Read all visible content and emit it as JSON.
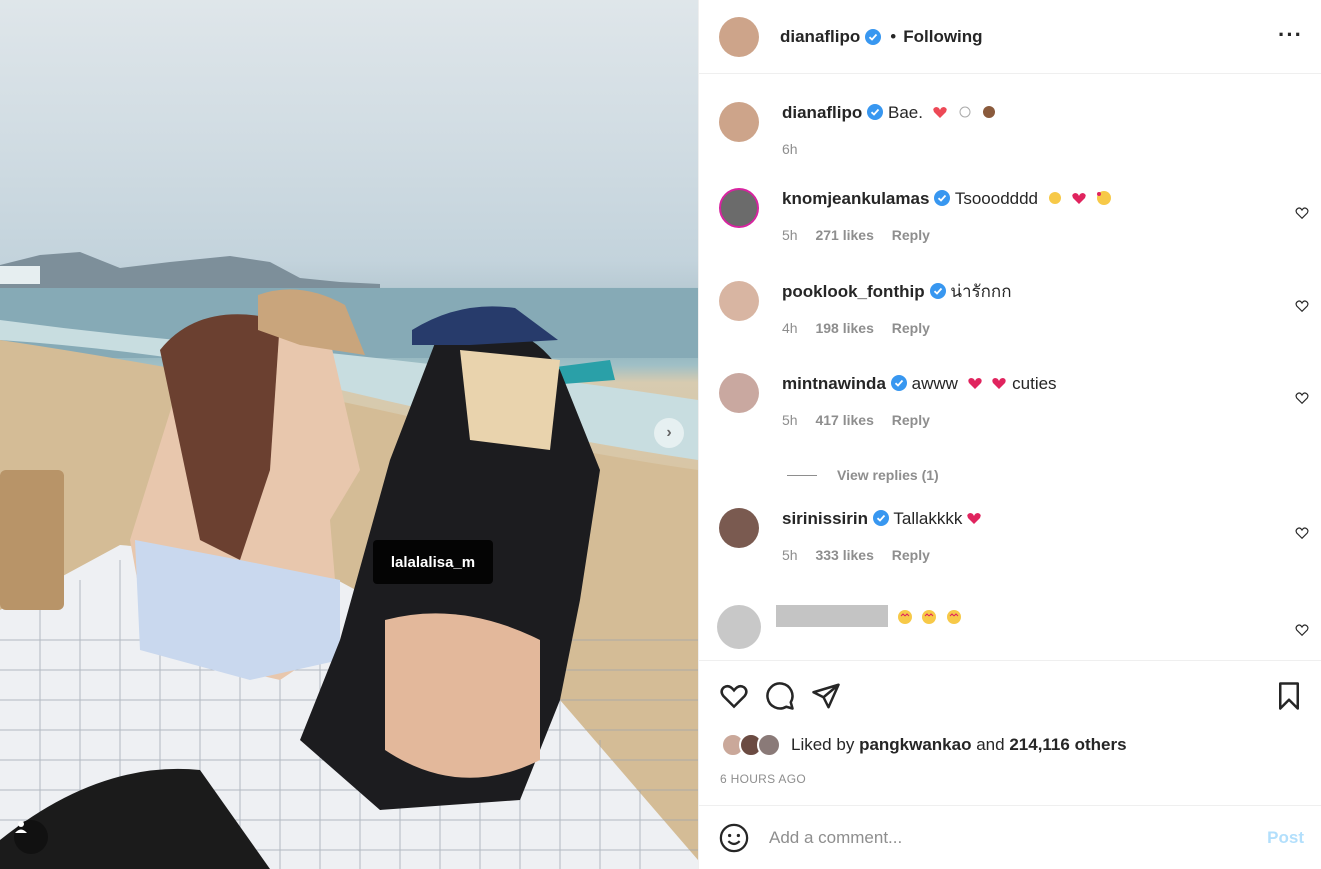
{
  "photo": {
    "tagged_user": "lalalalisa_m"
  },
  "post": {
    "author": "dianaflipo",
    "follow_status": "Following",
    "caption": "Bae.",
    "caption_time": "6h",
    "more_icon": "more-horizontal-icon"
  },
  "comments": [
    {
      "user": "knomjeankulamas",
      "text": "Tsooodddd",
      "emojis": [
        "clap-emoji",
        "red-heart-emoji",
        "smiling-hearts-emoji"
      ],
      "time": "5h",
      "likes": "271 likes",
      "reply": "Reply"
    },
    {
      "user": "pooklook_fonthip",
      "text": "น่ารักกก",
      "emojis": [],
      "time": "4h",
      "likes": "198 likes",
      "reply": "Reply"
    },
    {
      "user": "mintnawinda",
      "text": "awww",
      "text2": "cuties",
      "emojis": [
        "red-heart-emoji",
        "red-heart-emoji"
      ],
      "time": "5h",
      "likes": "417 likes",
      "reply": "Reply"
    },
    {
      "user": "sirinissirin",
      "text": "Tallakkkk",
      "emojis": [
        "red-heart-emoji"
      ],
      "time": "5h",
      "likes": "333 likes",
      "reply": "Reply"
    }
  ],
  "view_replies": "View replies (1)",
  "liked_by": {
    "prefix": "Liked by",
    "user": "pangkwankao",
    "middle": "and",
    "count": "214,116 others"
  },
  "timestamp": "6 HOURS AGO",
  "comment_box": {
    "placeholder": "Add a comment...",
    "post_label": "Post"
  },
  "colors": {
    "verified": "#3897f0",
    "heart": "#ed4956",
    "post_disabled": "#b2dffc",
    "muted": "#8e8e8e"
  }
}
